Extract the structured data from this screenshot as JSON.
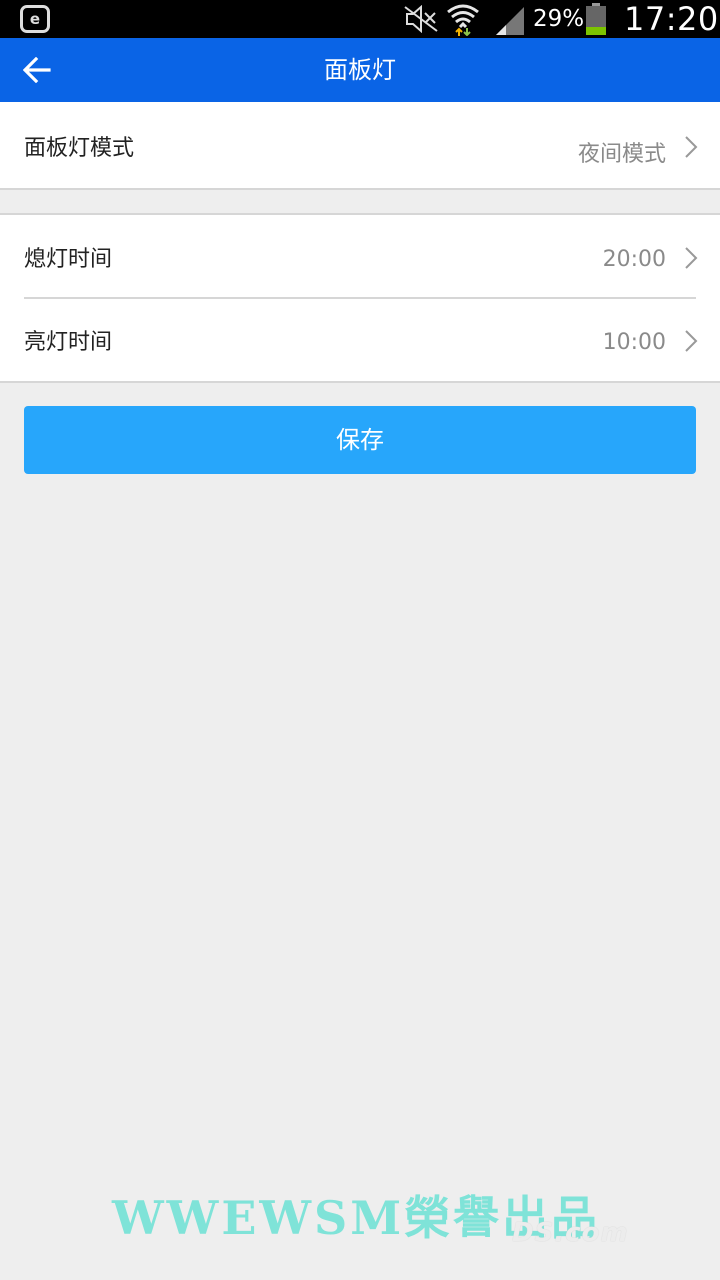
{
  "status_bar": {
    "left_icon_label": "e",
    "battery_percent": "29%",
    "time": "17:20"
  },
  "app_bar": {
    "title": "面板灯"
  },
  "mode_section": {
    "label": "面板灯模式",
    "value": "夜间模式"
  },
  "time_section": {
    "off_label": "熄灯时间",
    "off_value": "20:00",
    "on_label": "亮灯时间",
    "on_value": "10:00"
  },
  "save_button": {
    "label": "保存"
  },
  "watermark": {
    "main": "WWEWSM榮譽出品",
    "sub": "DS.com"
  },
  "colors": {
    "app_bar": "#0a64e6",
    "save_button": "#27a6fb",
    "background": "#eeeeee"
  }
}
